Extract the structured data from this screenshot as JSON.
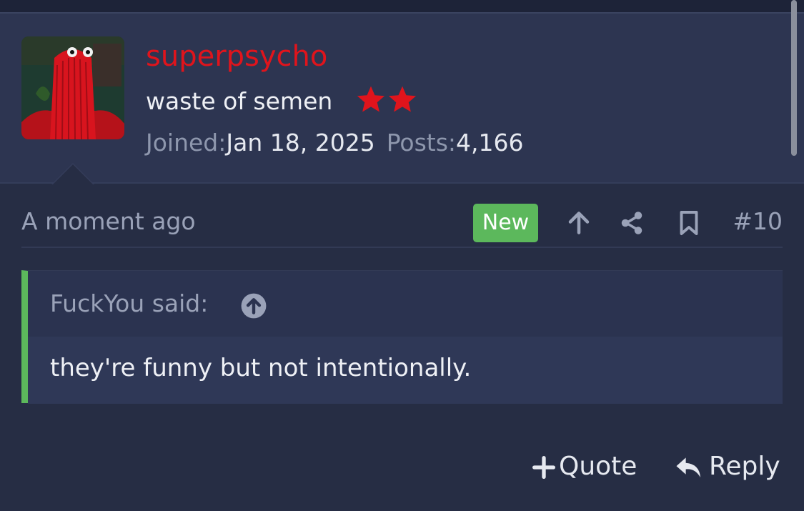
{
  "user": {
    "username": "superpsycho",
    "title": "waste of semen",
    "rank_stars": 2,
    "joined_label": "Joined:",
    "joined_value": "Jan 18, 2025",
    "posts_label": "Posts:",
    "posts_value": "4,166"
  },
  "post": {
    "timestamp": "A moment ago",
    "badge": "New",
    "number": "#10"
  },
  "quote": {
    "author_line": "FuckYou said:",
    "text": "they're funny but not intentionally."
  },
  "actions": {
    "quote_label": "Quote",
    "reply_label": "Reply"
  },
  "colors": {
    "username": "#e0141c",
    "star": "#e0141c",
    "new_badge": "#5cb85c",
    "quote_bar": "#5cb85c"
  },
  "icons": [
    "arrow-up-icon",
    "share-icon",
    "bookmark-icon",
    "quote-jump-icon",
    "plus-icon",
    "reply-icon"
  ]
}
